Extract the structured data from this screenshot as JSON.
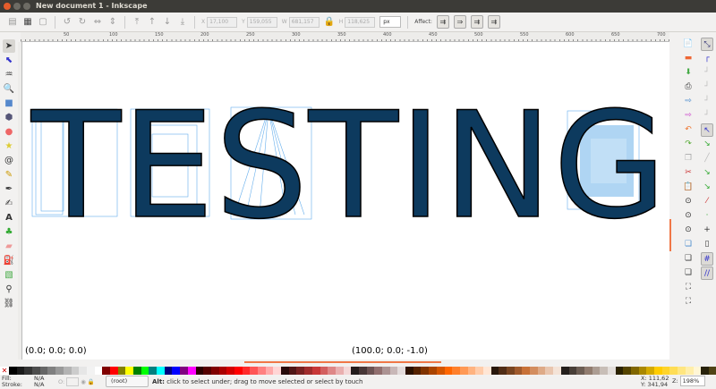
{
  "window": {
    "title": "New document 1 - Inkscape"
  },
  "toolbar": {
    "x_label": "X",
    "x_value": "17,100",
    "y_label": "Y",
    "y_value": "159,055",
    "w_label": "W",
    "w_value": "681,157",
    "h_label": "H",
    "h_value": "118,625",
    "unit": "px",
    "affect_label": "Affect:"
  },
  "ruler": {
    "labels": [
      "50",
      "100",
      "150",
      "200",
      "250",
      "300",
      "350",
      "400",
      "450",
      "500",
      "550",
      "600",
      "650",
      "700"
    ]
  },
  "canvas": {
    "text": "TESTING",
    "letter_color": "#0d3a5e",
    "highlight_color": "#3f9ae8",
    "point_left": "(0.0; 0.0; 0.0)",
    "point_right": "(100.0; 0.0; -1.0)"
  },
  "palette": [
    "#000000",
    "#1a1a1a",
    "#333333",
    "#4d4d4d",
    "#666666",
    "#808080",
    "#999999",
    "#b3b3b3",
    "#cccccc",
    "#e6e6e6",
    "#f2f2f2",
    "#ffffff",
    "#800000",
    "#ff0000",
    "#808000",
    "#ffff00",
    "#008000",
    "#00ff00",
    "#008080",
    "#00ffff",
    "#000080",
    "#0000ff",
    "#800080",
    "#ff00ff",
    "#2b0000",
    "#550000",
    "#800000",
    "#aa0000",
    "#d40000",
    "#ff0000",
    "#ff2a2a",
    "#ff5555",
    "#ff8080",
    "#ffaaaa",
    "#ffd5d5",
    "#280b0b",
    "#501616",
    "#782121",
    "#a02c2c",
    "#c83737",
    "#d35f5f",
    "#de8787",
    "#e9afaf",
    "#f4d7d7",
    "#241c1c",
    "#483737",
    "#6c5353",
    "#916f6f",
    "#ac9393",
    "#c8b7b7",
    "#e3dbdb",
    "#2b1100",
    "#552200",
    "#803300",
    "#aa4400",
    "#d45500",
    "#ff6600",
    "#ff7f2a",
    "#ff9955",
    "#ffb380",
    "#ffccaa",
    "#ffe6d5",
    "#28170b",
    "#502d16",
    "#784421",
    "#a05a2c",
    "#c87137",
    "#d38d5f",
    "#deaa87",
    "#e9c6af",
    "#f4e3d7",
    "#241f1c",
    "#483e37",
    "#6c5d53",
    "#917c6f",
    "#ac9d93",
    "#c8beb7",
    "#e3dedb",
    "#2b2200",
    "#554400",
    "#806600",
    "#aa8800",
    "#d4aa00",
    "#ffcc00",
    "#ffd42a",
    "#ffdd55",
    "#ffe680",
    "#ffeeaa",
    "#fff6d5",
    "#28220b",
    "#504416"
  ],
  "status": {
    "fill_label": "Fill:",
    "fill_value": "N/A",
    "stroke_label": "Stroke:",
    "stroke_value": "N/A",
    "opacity_label": "O:",
    "opacity_value": "",
    "layer": "(root)",
    "message_key": "Alt:",
    "message": " click to select under; drag to move selected or select by touch",
    "x": "X: 111,62",
    "y": "Y: 341,94",
    "zoom_label": "Z:",
    "zoom": "198%"
  }
}
